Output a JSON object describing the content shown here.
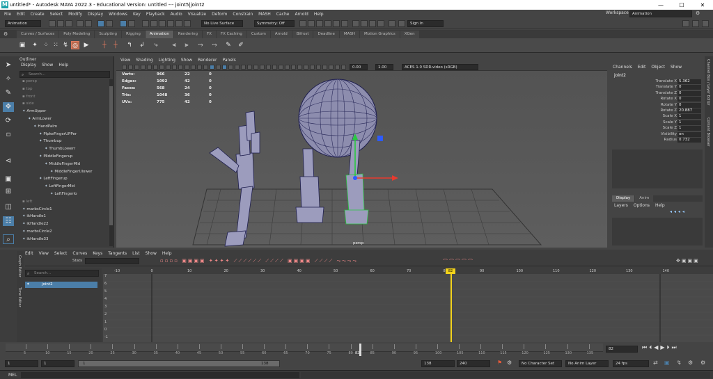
{
  "title": "untitled* - Autodesk MAYA 2022.3 - Educational Version: untitled  ---  joint5|joint2",
  "window_controls": {
    "min": "—",
    "max": "☐",
    "close": "✕"
  },
  "menu": [
    "File",
    "Edit",
    "Create",
    "Select",
    "Modify",
    "Display",
    "Windows",
    "Key",
    "Playback",
    "Audio",
    "Visualize",
    "Deform",
    "Constrain",
    "MASH",
    "Cache",
    "Arnold",
    "Help"
  ],
  "workspace": {
    "label": "Workspace :",
    "value": "Animation"
  },
  "status": {
    "menuset": "Animation",
    "live": "No Live Surface",
    "symmetry": "Symmetry: Off",
    "signin": "Sign In"
  },
  "shelf_tabs": [
    "Curves / Surfaces",
    "Poly Modeling",
    "Sculpting",
    "Rigging",
    "Animation",
    "Rendering",
    "FX",
    "FX Caching",
    "Custom",
    "Arnold",
    "Bifrost",
    "Deadline",
    "MASH",
    "Motion Graphics",
    "XGen"
  ],
  "shelf_active": "Animation",
  "outliner": {
    "title": "Outliner",
    "menu": [
      "Display",
      "Show",
      "Help"
    ],
    "search": "Search...",
    "items": [
      {
        "label": "persp",
        "indent": 0,
        "dim": true
      },
      {
        "label": "top",
        "indent": 0,
        "dim": true
      },
      {
        "label": "front",
        "indent": 0,
        "dim": true
      },
      {
        "label": "side",
        "indent": 0,
        "dim": true
      },
      {
        "label": "ArmUpper",
        "indent": 0
      },
      {
        "label": "ArmLower",
        "indent": 1
      },
      {
        "label": "HandPalm",
        "indent": 2
      },
      {
        "label": "PlpkeFingerUPPer",
        "indent": 3
      },
      {
        "label": "Thumbup",
        "indent": 3
      },
      {
        "label": "ThumbLowerr",
        "indent": 4
      },
      {
        "label": "MiddleFingerup",
        "indent": 3
      },
      {
        "label": "MiddleFingerMid",
        "indent": 4
      },
      {
        "label": "MiddleFingerUlower",
        "indent": 5
      },
      {
        "label": "LeftFingerup",
        "indent": 3
      },
      {
        "label": "LeftFingerMid",
        "indent": 4
      },
      {
        "label": "LeftFingerlo",
        "indent": 5
      },
      {
        "label": "left",
        "indent": 0,
        "dim": true
      },
      {
        "label": "marbsCircle1",
        "indent": 0
      },
      {
        "label": "ikHandle1",
        "indent": 0
      },
      {
        "label": "ikHandle22",
        "indent": 0
      },
      {
        "label": "marbsCircle2",
        "indent": 0
      },
      {
        "label": "ikHandle33",
        "indent": 0
      }
    ]
  },
  "viewport": {
    "menu": [
      "View",
      "Shading",
      "Lighting",
      "Show",
      "Renderer",
      "Panels"
    ],
    "field1": "0.00",
    "field2": "1.00",
    "colorspace": "ACES 1.0 SDR-video (sRGB)",
    "camera": "persp",
    "hud": [
      {
        "label": "Verts:",
        "a": "966",
        "b": "22",
        "c": "0"
      },
      {
        "label": "Edges:",
        "a": "1092",
        "b": "42",
        "c": "0"
      },
      {
        "label": "Faces:",
        "a": "568",
        "b": "24",
        "c": "0"
      },
      {
        "label": "Tris:",
        "a": "1048",
        "b": "36",
        "c": "0"
      },
      {
        "label": "UVs:",
        "a": "775",
        "b": "42",
        "c": "0"
      }
    ]
  },
  "channelbox": {
    "menu": [
      "Channels",
      "Edit",
      "Object",
      "Show"
    ],
    "node": "joint2",
    "channels": [
      {
        "name": "Translate X",
        "value": "5.362"
      },
      {
        "name": "Translate Y",
        "value": "0"
      },
      {
        "name": "Translate Z",
        "value": "0"
      },
      {
        "name": "Rotate X",
        "value": "0"
      },
      {
        "name": "Rotate Y",
        "value": "0"
      },
      {
        "name": "Rotate Z",
        "value": "20.887"
      },
      {
        "name": "Scale X",
        "value": "1"
      },
      {
        "name": "Scale Y",
        "value": "1"
      },
      {
        "name": "Scale Z",
        "value": "1"
      },
      {
        "name": "Visibility",
        "value": "on"
      },
      {
        "name": "Radius",
        "value": "0.732"
      }
    ],
    "layer_tabs": [
      "Display",
      "Anim"
    ],
    "layer_menu": [
      "Layers",
      "Options",
      "Help"
    ]
  },
  "side_tabs": [
    "Channel Box / Layer Editor",
    "Content Browser"
  ],
  "graph": {
    "side_label": "Graph Editor",
    "side_label2": "Time Editor",
    "menu": [
      "Edit",
      "View",
      "Select",
      "Curves",
      "Keys",
      "Tangents",
      "List",
      "Show",
      "Help"
    ],
    "stats_label": "Stats",
    "search": "Search...",
    "item": "joint2",
    "top_ticks": [
      "-10",
      "0",
      "10",
      "20",
      "30",
      "40",
      "50",
      "60",
      "70",
      "80",
      "90",
      "100",
      "110",
      "120",
      "130",
      "140"
    ],
    "left_ticks": [
      "7",
      "6",
      "5",
      "4",
      "3",
      "2",
      "1",
      "0",
      "-1"
    ],
    "current_frame": "82"
  },
  "timeslider": {
    "ticks": [
      "5",
      "10",
      "15",
      "20",
      "25",
      "30",
      "35",
      "40",
      "45",
      "50",
      "55",
      "60",
      "65",
      "70",
      "75",
      "80",
      "85",
      "90",
      "95",
      "100",
      "105",
      "110",
      "115",
      "120",
      "125",
      "130",
      "135"
    ],
    "current": "82",
    "field": "82",
    "current_fraction": 0.612
  },
  "range": {
    "start": "1",
    "start2": "1",
    "inner_start": "1",
    "inner_end": "138",
    "end": "138",
    "end2": "240",
    "character": "No Character Set",
    "anim_layer": "No Anim Layer",
    "fps": "24 fps"
  },
  "mel": {
    "label": "MEL"
  },
  "colors": {
    "selected": "#4b7ea8",
    "playhead": "#f2d21b",
    "accent_red": "#e85a3a",
    "manip_green": "#27c93f",
    "manip_blue": "#2d5bff"
  }
}
